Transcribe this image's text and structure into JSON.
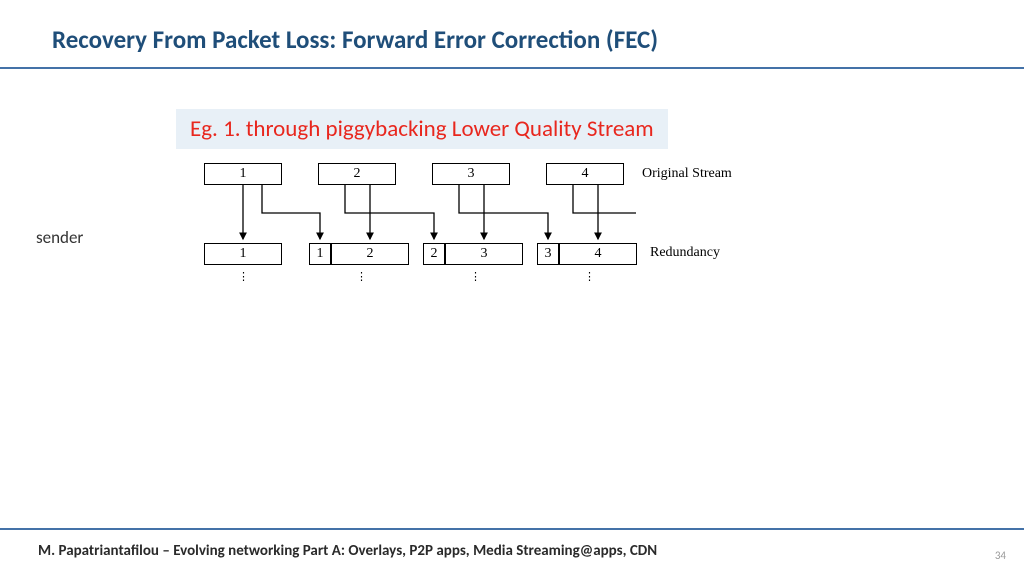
{
  "title": "Recovery From Packet Loss: Forward Error Correction (FEC)",
  "subtitle": "Eg. 1. through piggybacking Lower Quality Stream",
  "sender_label": "sender",
  "diagram": {
    "original_label": "Original Stream",
    "redundancy_label": "Redundancy",
    "top_boxes": [
      "1",
      "2",
      "3",
      "4"
    ],
    "bottom_boxes": [
      {
        "small": null,
        "main": "1"
      },
      {
        "small": "1",
        "main": "2"
      },
      {
        "small": "2",
        "main": "3"
      },
      {
        "small": "3",
        "main": "4"
      }
    ]
  },
  "footer": "M. Papatriantafilou –  Evolving networking Part A: Overlays, P2P apps, Media Streaming@apps, CDN",
  "page_number": "34",
  "chart_data": {
    "type": "diagram",
    "description": "FEC piggybacking scheme: each packet carries a low-quality copy of the previous packet",
    "original_stream": [
      1,
      2,
      3,
      4
    ],
    "redundancy_stream": [
      {
        "packet": 1,
        "piggyback": null
      },
      {
        "packet": 2,
        "piggyback": 1
      },
      {
        "packet": 3,
        "piggyback": 2
      },
      {
        "packet": 4,
        "piggyback": 3
      }
    ]
  }
}
